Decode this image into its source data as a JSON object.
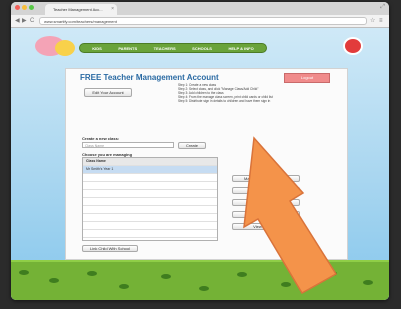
{
  "browser": {
    "tab_title": "Teacher Management Acc...",
    "tab_close": "×",
    "url": "www.smartify.com/teachers/management",
    "nav_back": "◀",
    "nav_forward": "▶",
    "nav_reload": "C",
    "star_icon": "☆",
    "menu_icon": "≡",
    "resize_icon": "⤢"
  },
  "site_nav": {
    "items": [
      "KIDS",
      "PARENTS",
      "TEACHERS",
      "SCHOOLS",
      "HELP & INFO"
    ]
  },
  "panel": {
    "title": "FREE Teacher Management Account",
    "logout_label": "Logout",
    "edit_account_label": "Edit Your Account",
    "steps": [
      "Step 1: Create a new class",
      "Step 2: Select class, and click \"Manage Class/Add Child\"",
      "Step 3: Add children to the class",
      "Step 4: From the manage class screen, print child cards or child list",
      "Step 5: Distribute sign in details to children and have them sign in"
    ],
    "create_class_label": "Create a new class:",
    "class_name_placeholder": "Class Name",
    "create_button": "Create",
    "choose_class_label": "Choose you are managing",
    "list_header": "Class Name",
    "classes": [
      "Mr Smith's Year 1",
      "",
      "",
      "",
      "",
      "",
      "",
      "",
      ""
    ],
    "link_school_button": "Link Child With School",
    "side_buttons": [
      "Manage Class/Add Child",
      "Rename Class",
      "Delete Class",
      "Manage Content",
      "View Progress"
    ]
  },
  "colors": {
    "title_blue": "#2a6aa3",
    "logout_red": "#f08b8b",
    "nav_green": "#6aa33a",
    "arrow_orange": "#f4934a"
  }
}
